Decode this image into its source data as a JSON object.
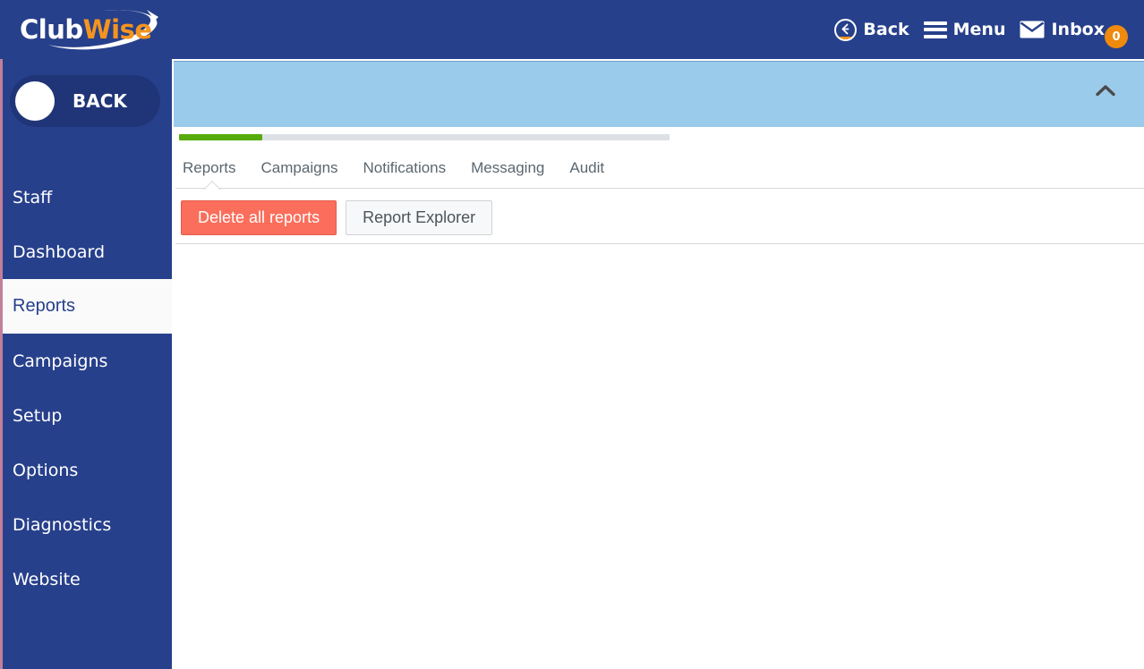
{
  "app": {
    "brand_club": "Club",
    "brand_wise": "Wise",
    "colors": {
      "navy": "#27408b",
      "orange": "#f5941f",
      "light_blue": "#9bcbeb",
      "green": "#56ab0b",
      "danger": "#fa6e5b",
      "sidebar_accent": "#c17f99"
    }
  },
  "topnav": {
    "items": [
      {
        "label": "Back",
        "icon": "back-circle-icon"
      },
      {
        "label": "Menu",
        "icon": "hamburger-icon"
      },
      {
        "label": "Inbox",
        "icon": "envelope-icon"
      }
    ],
    "inbox_badge_count": "0"
  },
  "sidebar": {
    "back_toggle_label": "BACK",
    "items": [
      {
        "label": "Staff",
        "active": false
      },
      {
        "label": "Dashboard",
        "active": false
      },
      {
        "label": "Reports",
        "active": true
      },
      {
        "label": "Campaigns",
        "active": false
      },
      {
        "label": "Setup",
        "active": false
      },
      {
        "label": "Options",
        "active": false
      },
      {
        "label": "Diagnostics",
        "active": false
      },
      {
        "label": "Website",
        "active": false
      }
    ]
  },
  "header_panel": {
    "collapse_icon": "chevron-up-icon",
    "progress_percent": 17
  },
  "tabs": [
    {
      "label": "Reports",
      "selected": true
    },
    {
      "label": "Campaigns",
      "selected": false
    },
    {
      "label": "Notifications",
      "selected": false
    },
    {
      "label": "Messaging",
      "selected": false
    },
    {
      "label": "Audit",
      "selected": false
    }
  ],
  "toolbar": {
    "delete_all_reports_label": "Delete all reports",
    "report_explorer_label": "Report Explorer"
  },
  "content": {
    "body_text": ""
  }
}
